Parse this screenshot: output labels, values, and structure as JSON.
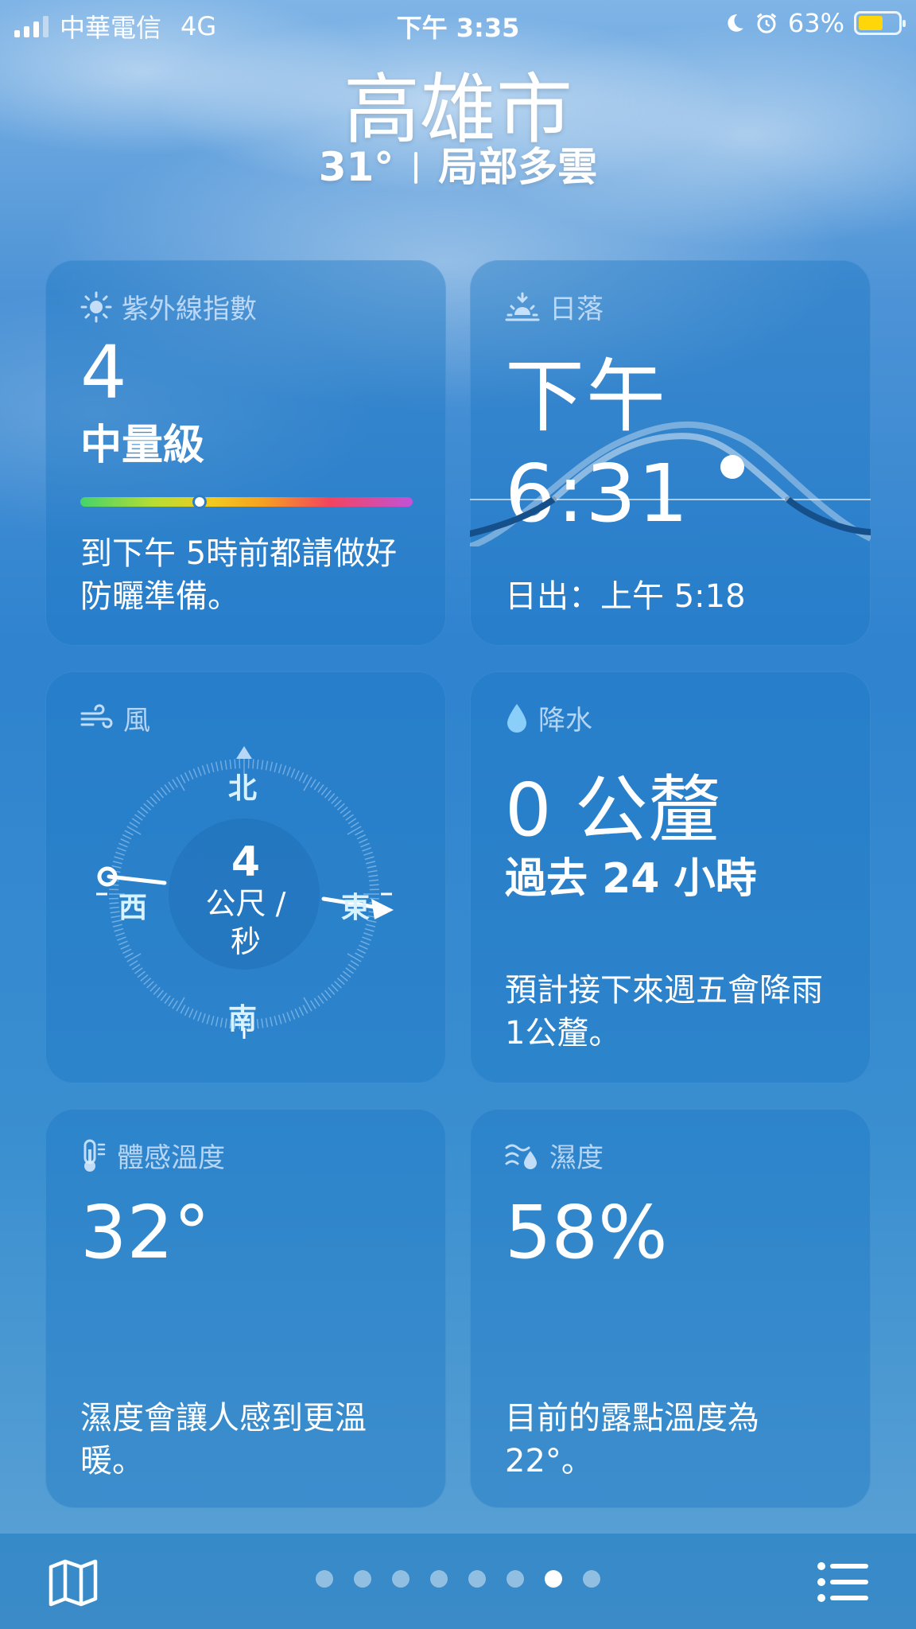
{
  "status_bar": {
    "carrier": "中華電信",
    "network": "4G",
    "time": "下午 3:35",
    "battery": "63%",
    "battery_color": "#FFD60A",
    "icons": [
      "signal-icon",
      "moon-icon",
      "alarm-icon",
      "battery-icon"
    ]
  },
  "header": {
    "city": "高雄市",
    "temperature": "31°",
    "condition": "局部多雲"
  },
  "uv": {
    "title": "紫外線指數",
    "value": "4",
    "level": "中量級",
    "bar_position": 0.36,
    "description": "到下午 5時前都請做好防曬準備。"
  },
  "sunset": {
    "title": "日落",
    "time": "下午 6:31",
    "sunrise": "日出：上午 5:18"
  },
  "wind": {
    "title": "風",
    "speed": "4",
    "unit": "公尺 / 秒",
    "north": "北",
    "south": "南",
    "east": "東",
    "west": "西"
  },
  "precipitation": {
    "title": "降水",
    "amount": "0 公釐",
    "period": "過去 24 小時",
    "description": "預計接下來週五會降雨1公釐。"
  },
  "feels_like": {
    "title": "體感溫度",
    "value": "32°",
    "description": "濕度會讓人感到更溫暖。"
  },
  "humidity": {
    "title": "濕度",
    "value": "58%",
    "description": "目前的露點溫度為22°。"
  },
  "bottom_bar": {
    "page_count": 8,
    "active_page": 7,
    "icons": [
      "map-icon",
      "list-icon"
    ]
  }
}
